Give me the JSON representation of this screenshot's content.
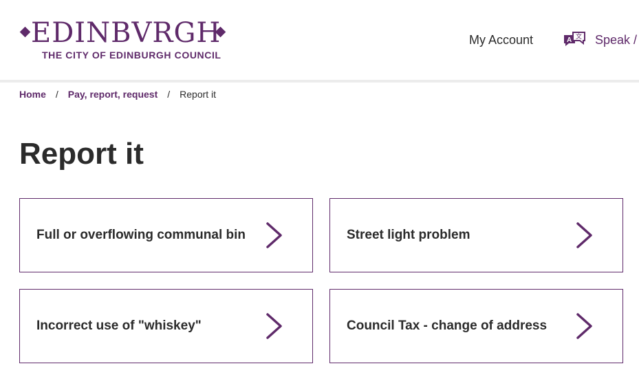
{
  "brand": {
    "logo_word": "EDINBVRGH",
    "logo_subtitle": "THE CITY OF EDINBURGH COUNCIL",
    "color": "#5f2a6a"
  },
  "header": {
    "my_account_label": "My Account",
    "speak_label": "Speak /",
    "speak_icon": "translate-speech-icon"
  },
  "breadcrumb": {
    "items": [
      {
        "label": "Home"
      },
      {
        "label": "Pay, report, request"
      },
      {
        "label": "Report it"
      }
    ],
    "separator": "/"
  },
  "page": {
    "title": "Report it"
  },
  "cards": [
    {
      "label": "Full or overflowing communal bin",
      "icon": "chevron-right-icon"
    },
    {
      "label": "Street light problem",
      "icon": "chevron-right-icon"
    },
    {
      "label": "Incorrect use of \"whiskey\"",
      "icon": "chevron-right-icon"
    },
    {
      "label": "Council Tax - change of address",
      "icon": "chevron-right-icon"
    }
  ]
}
